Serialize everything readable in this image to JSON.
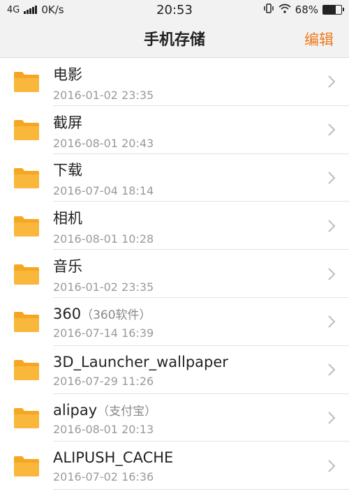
{
  "status_bar": {
    "network": "4G",
    "speed": "0K/s",
    "time": "20:53",
    "battery": "68%",
    "battery_level": 0.68
  },
  "header": {
    "title": "手机存储",
    "edit_label": "编辑"
  },
  "colors": {
    "accent": "#ee7a1c",
    "folder": "#f5a623"
  },
  "folders": [
    {
      "name": "电影",
      "note": "",
      "date": "2016-01-02 23:35"
    },
    {
      "name": "截屏",
      "note": "",
      "date": "2016-08-01 20:43"
    },
    {
      "name": "下载",
      "note": "",
      "date": "2016-07-04 18:14"
    },
    {
      "name": "相机",
      "note": "",
      "date": "2016-08-01 10:28"
    },
    {
      "name": "音乐",
      "note": "",
      "date": "2016-01-02 23:35"
    },
    {
      "name": "360",
      "note": "（360软件）",
      "date": "2016-07-14 16:39"
    },
    {
      "name": "3D_Launcher_wallpaper",
      "note": "",
      "date": "2016-07-29 11:26"
    },
    {
      "name": "alipay",
      "note": "（支付宝）",
      "date": "2016-08-01 20:13"
    },
    {
      "name": "ALIPUSH_CACHE",
      "note": "",
      "date": "2016-07-02 16:36"
    }
  ]
}
